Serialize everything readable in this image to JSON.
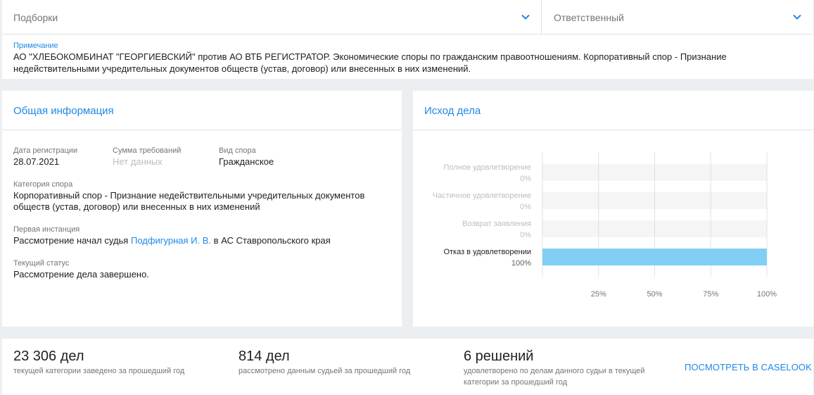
{
  "filters": {
    "podborki_label": "Подборки",
    "responsible_label": "Ответственный"
  },
  "note": {
    "label": "Примечание",
    "text": "АО \"ХЛЕБОКОМБИНАТ \"ГЕОРГИЕВСКИЙ\" против АО ВТБ РЕГИСТРАТОР. Экономические споры по гражданским правоотношениям. Корпоративный спор - Признание недействительными учредительных документов обществ (устав, договор) или внесенных в них изменений."
  },
  "general": {
    "title": "Общая информация",
    "reg_date_label": "Дата регистрации",
    "reg_date_value": "28.07.2021",
    "claim_sum_label": "Сумма требований",
    "claim_sum_value": "Нет данных",
    "dispute_type_label": "Вид спора",
    "dispute_type_value": "Гражданское",
    "category_label": "Категория спора",
    "category_value": "Корпоративный спор - Признание недействительными учредительных документов обществ (устав, договор) или внесенных в них изменений",
    "first_instance_label": "Первая инстанция",
    "first_instance_prefix": "Рассмотрение начал судья",
    "first_instance_judge": "Подфигурная И. В.",
    "first_instance_suffix": "в АС Ставропольского края",
    "status_label": "Текущий статус",
    "status_value": "Рассмотрение дела завершено."
  },
  "outcome": {
    "title": "Исход дела"
  },
  "chart_data": {
    "type": "bar",
    "orientation": "horizontal",
    "categories": [
      "Полное удовлетворение",
      "Частичное удовлетворение",
      "Возврат заявления",
      "Отказ в удовлетворении"
    ],
    "values": [
      0,
      0,
      0,
      100
    ],
    "value_labels": [
      "0%",
      "0%",
      "0%",
      "100%"
    ],
    "x_ticks": [
      "25%",
      "50%",
      "75%",
      "100%"
    ],
    "xlim": [
      0,
      100
    ],
    "grid": true,
    "colors": {
      "bar": "#81cff4",
      "track": "#f5f5f5",
      "grid": "#e0e0e0",
      "muted_label": "#bdbdbd",
      "active_label": "#212121"
    }
  },
  "stats": [
    {
      "number": "23 306 дел",
      "desc": "текущей категории заведено за прошедший год"
    },
    {
      "number": "814 дел",
      "desc": "рассмотрено данным судьей за прошедший год"
    },
    {
      "number": "6 решений",
      "desc": "удовлетворено по делам данного судьи в текущей категории за прошедший год"
    }
  ],
  "caselook_link": "ПОСМОТРЕТЬ В CASELOOK"
}
